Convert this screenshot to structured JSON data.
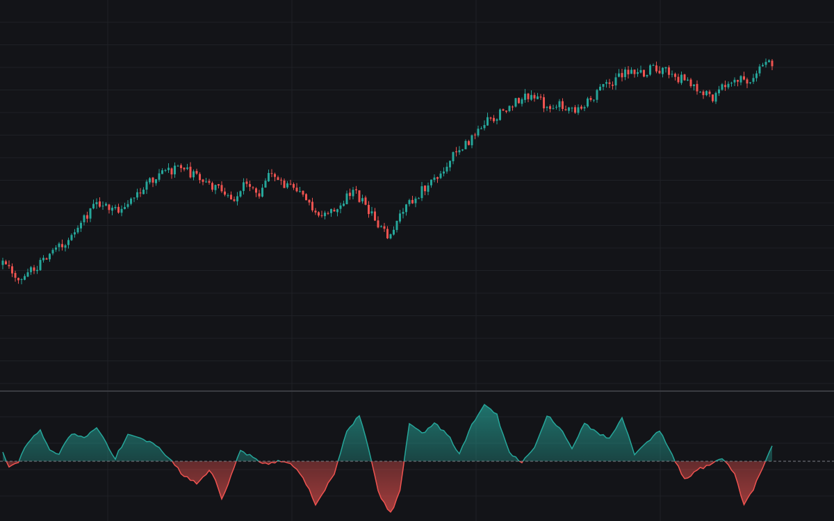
{
  "theme": {
    "background": "#131418",
    "grid": "#1f2126",
    "separator": "#3a3c42",
    "zero_line": "#7d8088",
    "up": "#26a69a",
    "down": "#ef5350"
  },
  "chart_data": [
    {
      "type": "candlestick",
      "panel": "price",
      "title": "",
      "grid": true,
      "y_axis_labels": false,
      "anchors": [
        [
          0,
          160
        ],
        [
          5,
          140
        ],
        [
          12,
          160
        ],
        [
          19,
          185
        ],
        [
          26,
          220
        ],
        [
          31,
          240
        ],
        [
          37,
          232
        ],
        [
          44,
          255
        ],
        [
          50,
          275
        ],
        [
          56,
          285
        ],
        [
          60,
          278
        ],
        [
          66,
          262
        ],
        [
          70,
          258
        ],
        [
          74,
          242
        ],
        [
          78,
          268
        ],
        [
          82,
          250
        ],
        [
          86,
          280
        ],
        [
          90,
          262
        ],
        [
          96,
          250
        ],
        [
          100,
          228
        ],
        [
          104,
          226
        ],
        [
          109,
          242
        ],
        [
          112,
          254
        ],
        [
          116,
          236
        ],
        [
          120,
          210
        ],
        [
          123,
          195
        ],
        [
          130,
          240
        ],
        [
          138,
          270
        ],
        [
          144,
          300
        ],
        [
          150,
          322
        ],
        [
          154,
          342
        ],
        [
          160,
          356
        ],
        [
          165,
          373
        ],
        [
          170,
          376
        ],
        [
          174,
          362
        ],
        [
          178,
          368
        ],
        [
          182,
          358
        ],
        [
          186,
          364
        ],
        [
          190,
          382
        ],
        [
          196,
          398
        ],
        [
          200,
          408
        ],
        [
          204,
          404
        ],
        [
          208,
          415
        ],
        [
          212,
          408
        ],
        [
          216,
          400
        ],
        [
          220,
          392
        ],
        [
          224,
          380
        ],
        [
          227,
          376
        ],
        [
          230,
          392
        ],
        [
          234,
          400
        ],
        [
          238,
          395
        ],
        [
          242,
          410
        ],
        [
          246,
          420
        ]
      ],
      "total_candles": 247,
      "seed": 7,
      "ylim": [
        0,
        500
      ]
    },
    {
      "type": "area",
      "panel": "oscillator",
      "baseline": 0,
      "anchors": [
        [
          0,
          5
        ],
        [
          2,
          -3
        ],
        [
          5,
          0
        ],
        [
          8,
          12
        ],
        [
          12,
          20
        ],
        [
          15,
          8
        ],
        [
          18,
          5
        ],
        [
          22,
          18
        ],
        [
          26,
          15
        ],
        [
          30,
          22
        ],
        [
          33,
          12
        ],
        [
          36,
          2
        ],
        [
          40,
          18
        ],
        [
          44,
          15
        ],
        [
          48,
          12
        ],
        [
          52,
          4
        ],
        [
          55,
          -2
        ],
        [
          58,
          -10
        ],
        [
          62,
          -14
        ],
        [
          66,
          -6
        ],
        [
          68,
          -12
        ],
        [
          70,
          -24
        ],
        [
          73,
          -10
        ],
        [
          76,
          8
        ],
        [
          80,
          2
        ],
        [
          84,
          -2
        ],
        [
          88,
          0
        ],
        [
          92,
          -1
        ],
        [
          96,
          -10
        ],
        [
          100,
          -28
        ],
        [
          103,
          -18
        ],
        [
          106,
          -8
        ],
        [
          110,
          20
        ],
        [
          114,
          30
        ],
        [
          118,
          0
        ],
        [
          120,
          -20
        ],
        [
          124,
          -34
        ],
        [
          127,
          -20
        ],
        [
          130,
          25
        ],
        [
          134,
          18
        ],
        [
          138,
          25
        ],
        [
          142,
          18
        ],
        [
          146,
          5
        ],
        [
          150,
          24
        ],
        [
          154,
          38
        ],
        [
          158,
          30
        ],
        [
          162,
          5
        ],
        [
          166,
          0
        ],
        [
          170,
          8
        ],
        [
          174,
          30
        ],
        [
          178,
          22
        ],
        [
          182,
          8
        ],
        [
          186,
          25
        ],
        [
          190,
          18
        ],
        [
          194,
          15
        ],
        [
          198,
          28
        ],
        [
          202,
          5
        ],
        [
          206,
          12
        ],
        [
          210,
          20
        ],
        [
          214,
          4
        ],
        [
          218,
          -12
        ],
        [
          222,
          -6
        ],
        [
          226,
          -2
        ],
        [
          230,
          2
        ],
        [
          234,
          -8
        ],
        [
          237,
          -28
        ],
        [
          240,
          -18
        ],
        [
          243,
          -4
        ],
        [
          246,
          10
        ]
      ],
      "total_points": 247,
      "ylim": [
        -40,
        40
      ]
    }
  ]
}
